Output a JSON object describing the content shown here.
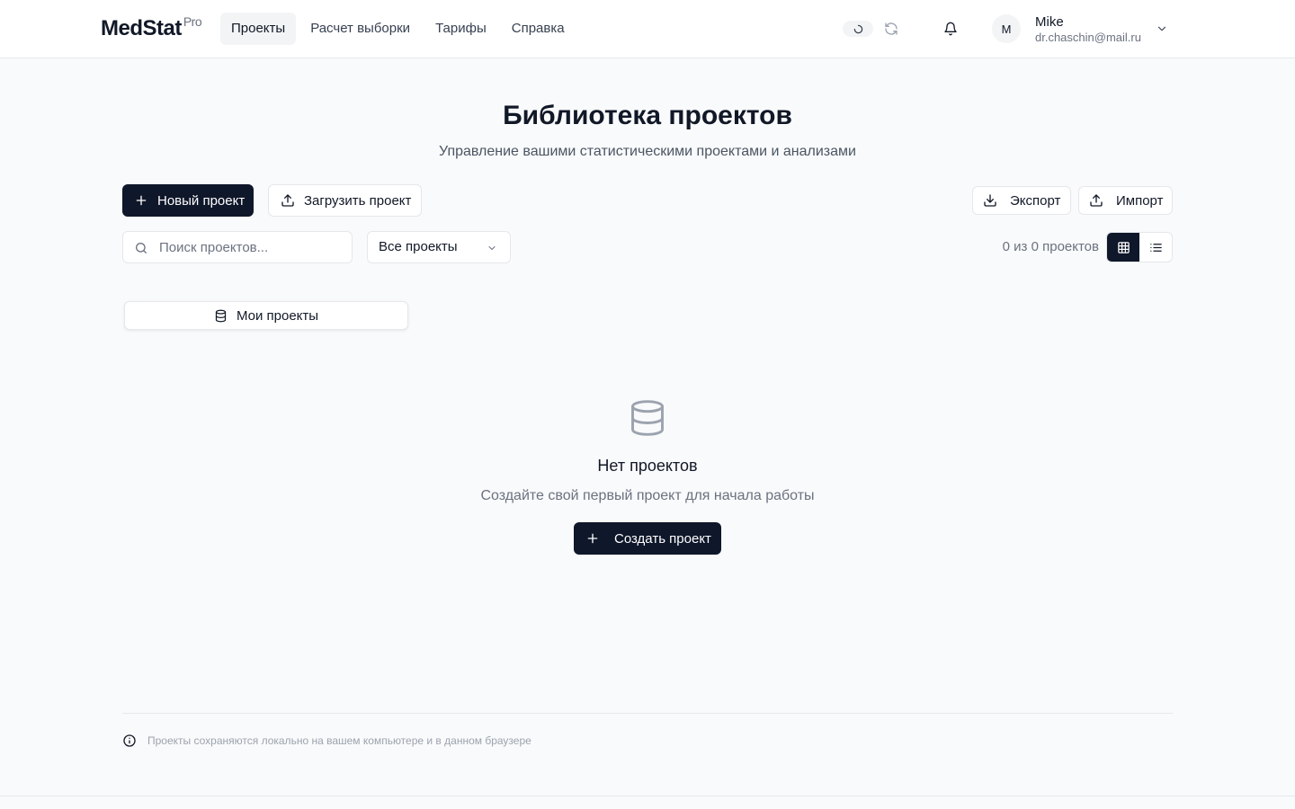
{
  "header": {
    "logo": "MedStat",
    "logo_badge": "Pro",
    "nav": [
      {
        "label": "Проекты",
        "active": true
      },
      {
        "label": "Расчет выборки",
        "active": false
      },
      {
        "label": "Тарифы",
        "active": false
      },
      {
        "label": "Справка",
        "active": false
      }
    ],
    "user": {
      "initial": "M",
      "name": "Mike",
      "email": "dr.chaschin@mail.ru"
    }
  },
  "page": {
    "title": "Библиотека проектов",
    "subtitle": "Управление вашими статистическими проектами и анализами"
  },
  "toolbar": {
    "new_project": "Новый проект",
    "upload_project": "Загрузить проект",
    "export": "Экспорт",
    "import": "Импорт"
  },
  "filters": {
    "search_placeholder": "Поиск проектов...",
    "select_value": "Все проекты",
    "count_text": "0 из 0 проектов"
  },
  "tabs": {
    "my_projects": "Мои проекты"
  },
  "empty_state": {
    "title": "Нет проектов",
    "text": "Создайте свой первый проект для начала работы",
    "button": "Создать проект"
  },
  "footer": {
    "note": "Проекты сохраняются локально на вашем компьютере и в данном браузере"
  },
  "colors": {
    "primary": "#0f172a",
    "background": "#f9fafb",
    "border": "#e5e7eb",
    "muted_text": "#6b7280"
  },
  "icons": [
    "plus-icon",
    "upload-icon",
    "download-icon",
    "search-icon",
    "chevron-down-icon",
    "grid-icon",
    "list-icon",
    "database-icon",
    "bell-icon",
    "refresh-icon",
    "info-icon"
  ]
}
